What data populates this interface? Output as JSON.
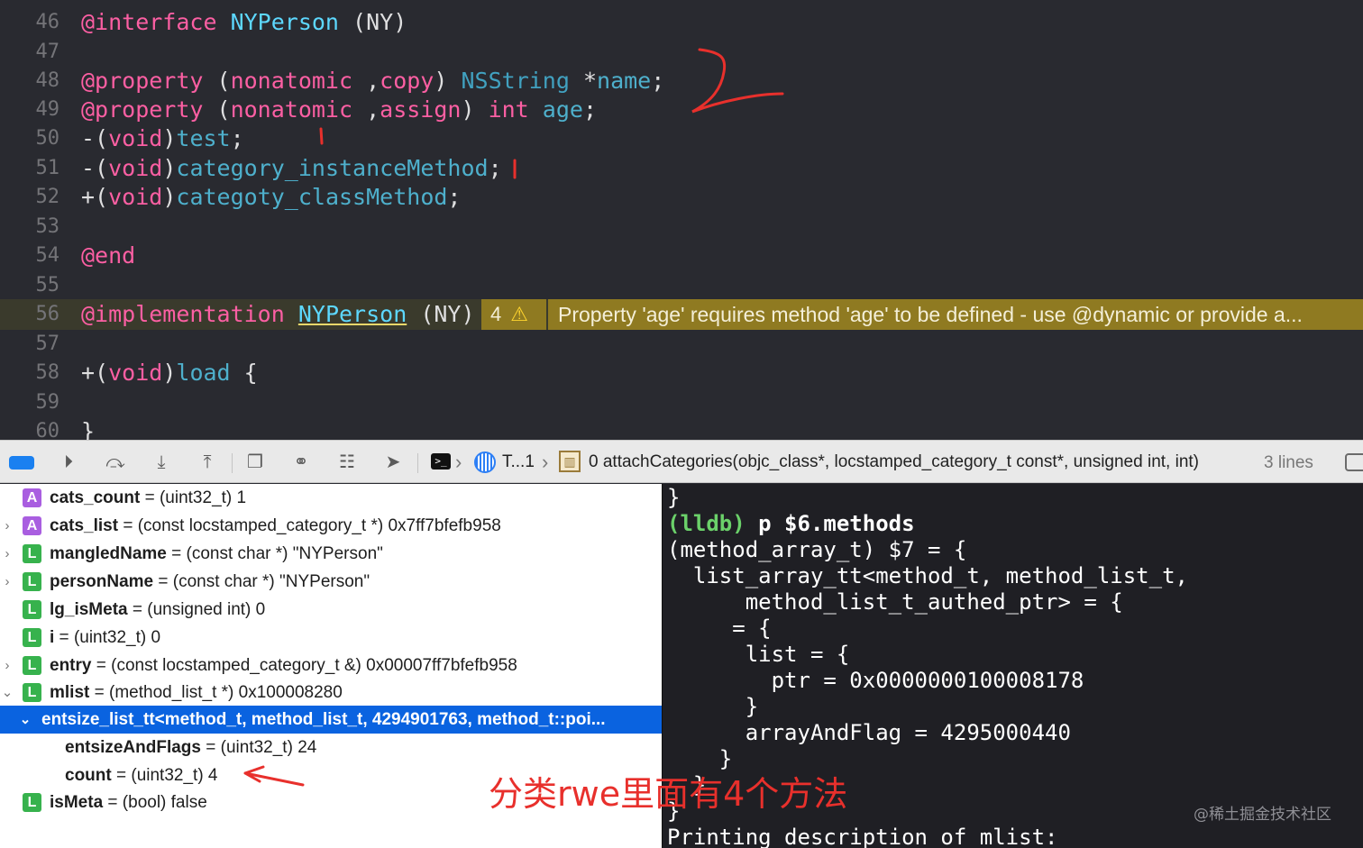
{
  "editor": {
    "lines": [
      {
        "n": "46"
      },
      {
        "n": "47"
      },
      {
        "n": "48"
      },
      {
        "n": "49"
      },
      {
        "n": "50"
      },
      {
        "n": "51"
      },
      {
        "n": "52"
      },
      {
        "n": "53"
      },
      {
        "n": "54"
      },
      {
        "n": "55"
      },
      {
        "n": "56"
      },
      {
        "n": "57"
      },
      {
        "n": "58"
      },
      {
        "n": "59"
      },
      {
        "n": "60"
      }
    ],
    "code": {
      "l46": {
        "kw": "@interface",
        "cls": "NYPerson",
        "rest": " (NY)"
      },
      "l48": {
        "kw": "@property",
        "p1": " (",
        "attr1": "nonatomic",
        "p2": " ,",
        "attr2": "copy",
        "p3": ") ",
        "type": "NSString",
        "p4": " *",
        "name": "name",
        "end": ";"
      },
      "l49": {
        "kw": "@property",
        "p1": " (",
        "attr1": "nonatomic",
        "p2": " ,",
        "attr2": "assign",
        "p3": ") ",
        "type": "int",
        "p4": " ",
        "name": "age",
        "end": ";"
      },
      "l50": {
        "sign": "-(",
        "ret": "void",
        "close": ")",
        "name": "test",
        "end": ";"
      },
      "l51": {
        "sign": "-(",
        "ret": "void",
        "close": ")",
        "name": "category_instanceMethod",
        "end": ";"
      },
      "l52": {
        "sign": "+(",
        "ret": "void",
        "close": ")",
        "name": "categoty_classMethod",
        "end": ";"
      },
      "l54": {
        "kw": "@end"
      },
      "l56": {
        "kw": "@implementation",
        "cls": "NYPerson",
        "rest": " (NY)"
      },
      "l58": {
        "sign": "+(",
        "ret": "void",
        "close": ")",
        "name": "load",
        "end": " {"
      },
      "l60": {
        "text": "}"
      }
    },
    "warning": {
      "count": "4",
      "icon": "warning-triangle-icon",
      "message": "Property 'age' requires method 'age' to be defined - use @dynamic or provide a..."
    }
  },
  "toolbar": {
    "thread_label": "T...1",
    "frame_label": "0 attachCategories(objc_class*, locstamped_category_t const*, unsigned int, int)",
    "lines_label": "3 lines",
    "accent": "#1a80f0"
  },
  "variables": [
    {
      "kind": "A",
      "expand": "",
      "name": "cats_count",
      "eq": " = ",
      "type": "(uint32_t)",
      "value": " 1"
    },
    {
      "kind": "A",
      "expand": "›",
      "name": "cats_list",
      "eq": " = ",
      "type": "(const locstamped_category_t *)",
      "value": " 0x7ff7bfefb958"
    },
    {
      "kind": "L",
      "expand": "›",
      "name": "mangledName",
      "eq": " = ",
      "type": "(const char *)",
      "value": " \"NYPerson\""
    },
    {
      "kind": "L",
      "expand": "›",
      "name": "personName",
      "eq": " = ",
      "type": "(const char *)",
      "value": " \"NYPerson\""
    },
    {
      "kind": "L",
      "expand": "",
      "name": "lg_isMeta",
      "eq": " = ",
      "type": "(unsigned int)",
      "value": " 0"
    },
    {
      "kind": "L",
      "expand": "",
      "name": "i",
      "eq": " = ",
      "type": "(uint32_t)",
      "value": " 0"
    },
    {
      "kind": "L",
      "expand": "›",
      "name": "entry",
      "eq": " = ",
      "type": "(const locstamped_category_t &)",
      "value": " 0x00007ff7bfefb958"
    },
    {
      "kind": "L",
      "expand": "⌄",
      "name": "mlist",
      "eq": " = ",
      "type": "(method_list_t *)",
      "value": " 0x100008280"
    },
    {
      "kind": "",
      "expand": "⌄",
      "name": "entsize_list_tt<method_t, method_list_t, 4294901763, method_t::poi...",
      "eq": "",
      "type": "",
      "value": ""
    },
    {
      "kind": "",
      "expand": "",
      "name": "entsizeAndFlags",
      "eq": " = ",
      "type": "(uint32_t)",
      "value": " 24"
    },
    {
      "kind": "",
      "expand": "",
      "name": "count",
      "eq": " = ",
      "type": "(uint32_t)",
      "value": " 4"
    },
    {
      "kind": "L",
      "expand": "",
      "name": "isMeta",
      "eq": " = ",
      "type": "(bool)",
      "value": " false"
    }
  ],
  "console": {
    "lines": [
      {
        "text": "}"
      },
      {
        "prompt": "(lldb)",
        "cmd": " p $6.methods"
      },
      {
        "text": "(method_array_t) $7 = {"
      },
      {
        "text": "  list_array_tt<method_t, method_list_t,"
      },
      {
        "text": "      method_list_t_authed_ptr> = {"
      },
      {
        "text": "     = {"
      },
      {
        "text": "      list = {"
      },
      {
        "text": "        ptr = 0x0000000100008178"
      },
      {
        "text": "      }"
      },
      {
        "text": "      arrayAndFlag = 4295000440"
      },
      {
        "text": "    }"
      },
      {
        "text": "  }"
      },
      {
        "text": "}"
      },
      {
        "text": "Printing description of mlist:"
      }
    ]
  },
  "annotation": {
    "text": "分类rwe里面有4个方法",
    "color": "#e8302c"
  },
  "watermark": "@稀土掘金技术社区"
}
